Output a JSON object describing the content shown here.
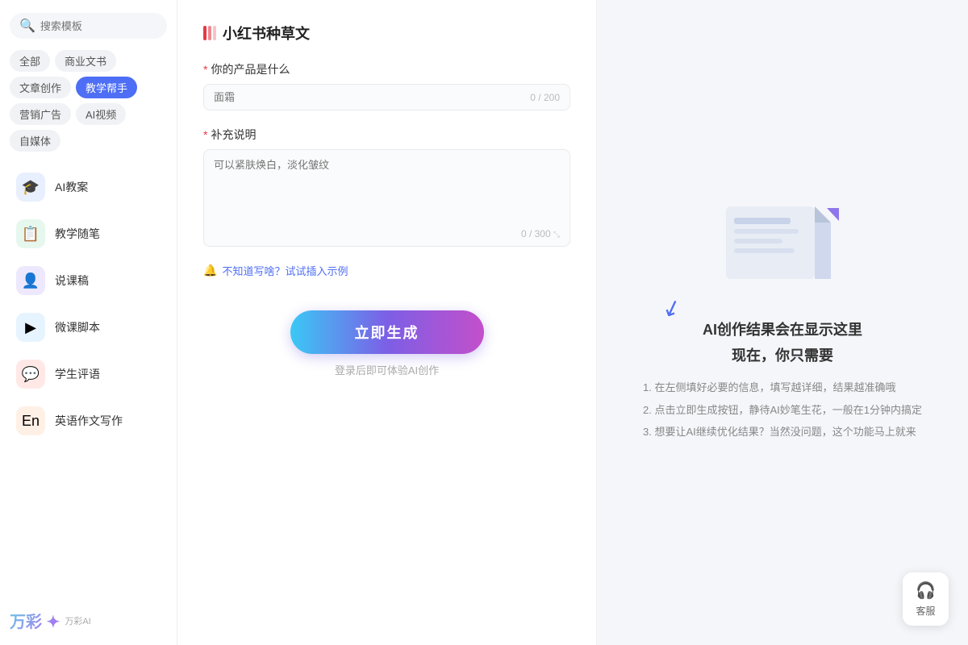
{
  "sidebar": {
    "search_placeholder": "搜索模板",
    "tags": [
      {
        "label": "全部",
        "active": false
      },
      {
        "label": "商业文书",
        "active": false
      },
      {
        "label": "文章创作",
        "active": false
      },
      {
        "label": "教学帮手",
        "active": true
      },
      {
        "label": "营销广告",
        "active": false
      },
      {
        "label": "AI视频",
        "active": false
      },
      {
        "label": "自媒体",
        "active": false
      }
    ],
    "items": [
      {
        "id": "ai-lesson",
        "label": "AI教案",
        "icon": "🎓",
        "icon_class": "icon-blue"
      },
      {
        "id": "teaching-notes",
        "label": "教学随笔",
        "icon": "📋",
        "icon_class": "icon-green"
      },
      {
        "id": "lecture-draft",
        "label": "说课稿",
        "icon": "👤",
        "icon_class": "icon-purple"
      },
      {
        "id": "micro-script",
        "label": "微课脚本",
        "icon": "▶",
        "icon_class": "icon-cyan"
      },
      {
        "id": "student-comment",
        "label": "学生评语",
        "icon": "💬",
        "icon_class": "icon-red"
      },
      {
        "id": "english-essay",
        "label": "英语作文写作",
        "icon": "En",
        "icon_class": "icon-orange"
      }
    ],
    "logo": "万彩 ✦",
    "logo_sub": "万彩AI"
  },
  "form": {
    "title": "小红书种草文",
    "field1": {
      "label": "你的产品是什么",
      "placeholder": "面霜",
      "char_count": "0 / 200"
    },
    "field2": {
      "label": "补充说明",
      "placeholder": "可以紧肤焕白，淡化皱纹",
      "char_count": "0 / 300"
    },
    "hint_icon": "🔔",
    "hint_text": "不知道写啥？试试插入示例",
    "generate_btn": "立即生成",
    "login_hint": "登录后即可体验AI创作"
  },
  "result_panel": {
    "title_line1": "AI创作结果会在显示这里",
    "title_line2": "现在，你只需要",
    "steps": [
      "1. 在左侧填好必要的信息，填写越详细，结果越准确哦",
      "2. 点击立即生成按钮，静待AI妙笔生花，一般在1分钟内搞定",
      "3. 想要让AI继续优化结果？当然没问题，这个功能马上就来"
    ]
  },
  "customer_service": {
    "icon": "🎧",
    "label": "客服"
  }
}
